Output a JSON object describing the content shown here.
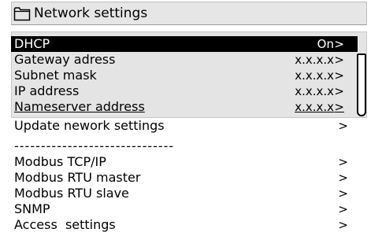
{
  "header": {
    "title": "Network settings",
    "icon": "folder-icon"
  },
  "network_rows": [
    {
      "label": "DHCP",
      "value": "On",
      "chevron": ">"
    },
    {
      "label": "Gateway adress",
      "value": "x.x.x.x",
      "chevron": ">"
    },
    {
      "label": "Subnet mask",
      "value": "x.x.x.x",
      "chevron": ">"
    },
    {
      "label": "IP address",
      "value": "x.x.x.x",
      "chevron": ">"
    },
    {
      "label": "Nameserver address",
      "value": "x.x.x.x",
      "chevron": ">"
    }
  ],
  "update_row": {
    "label": "Update nework settings",
    "chevron": ">"
  },
  "separator": "------------------------------",
  "menu_rows": [
    {
      "label": "Modbus TCP/IP",
      "chevron": ">"
    },
    {
      "label": "Modbus RTU master",
      "chevron": ">"
    },
    {
      "label": "Modbus RTU slave",
      "chevron": ">"
    },
    {
      "label": "SNMP",
      "chevron": ">"
    },
    {
      "label": "Access  settings",
      "chevron": ">"
    }
  ],
  "colors": {
    "selected_bg": "#000000",
    "list_bg": "#e4e4e4",
    "header_bg": "#e6e6e6"
  }
}
